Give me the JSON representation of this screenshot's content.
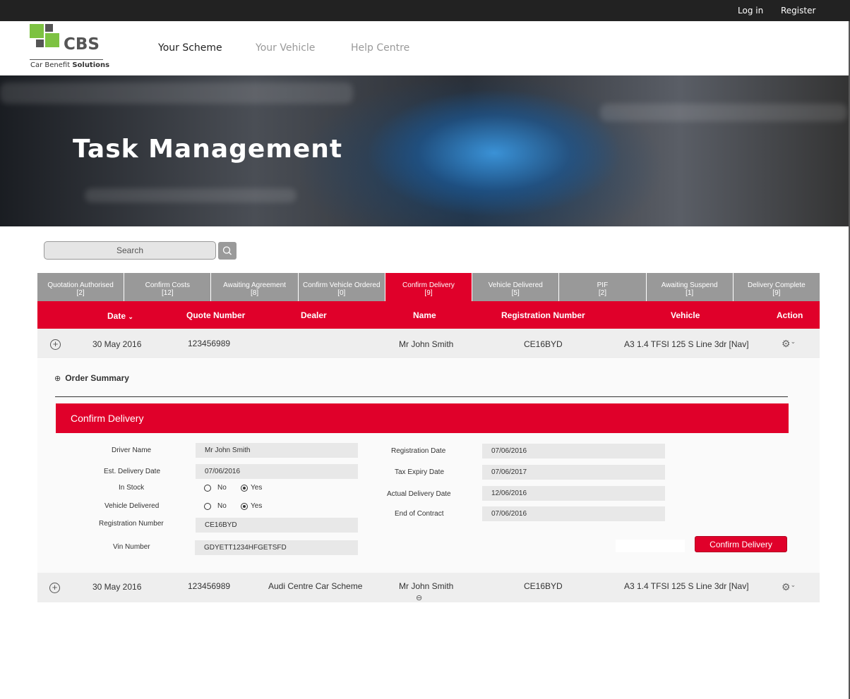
{
  "topbar": {
    "login": "Log in",
    "register": "Register"
  },
  "logo": {
    "text": "CBS",
    "subtitle_a": "Car Benefit ",
    "subtitle_b": "Solutions"
  },
  "nav": {
    "items": [
      "Your Scheme",
      "Your Vehicle",
      "Help Centre"
    ]
  },
  "hero": {
    "title": "Task Management"
  },
  "search": {
    "placeholder": "Search"
  },
  "tabs": [
    {
      "label": "Quotation Authorised",
      "count": "[2]"
    },
    {
      "label": "Confirm Costs",
      "count": "[12]"
    },
    {
      "label": "Awaiting Agreement",
      "count": "[8]"
    },
    {
      "label": "Confirm Vehicle Ordered",
      "count": "[0]"
    },
    {
      "label": "Confirm Delivery",
      "count": "[9]"
    },
    {
      "label": "Vehicle Delivered",
      "count": "[5]"
    },
    {
      "label": "PIF",
      "count": "[2]"
    },
    {
      "label": "Awaiting Suspend",
      "count": "[1]"
    },
    {
      "label": "Delivery Complete",
      "count": "[9]"
    }
  ],
  "table": {
    "headers": {
      "date": "Date",
      "quote": "Quote Number",
      "dealer": "Dealer",
      "name": "Name",
      "reg": "Registration Number",
      "vehicle": "Vehicle",
      "action": "Action"
    },
    "rows": [
      {
        "date": "30 May 2016",
        "quote": "123456989",
        "dealer": "",
        "name": "Mr John Smith",
        "reg": "CE16BYD",
        "vehicle": "A3 1.4 TFSI 125 S Line 3dr [Nav]"
      },
      {
        "date": "30 May 2016",
        "quote": "123456989",
        "dealer": "Audi Centre Car Scheme",
        "name": "Mr John Smith",
        "reg": "CE16BYD",
        "vehicle": "A3 1.4 TFSI 125 S Line 3dr [Nav]"
      }
    ]
  },
  "detail": {
    "order_summary": "Order Summary",
    "section_title": "Confirm Delivery",
    "labels": {
      "driver_name": "Driver Name",
      "est_delivery": "Est. Delivery Date",
      "in_stock": "In Stock",
      "vehicle_delivered": "Vehicle Delivered",
      "reg_number": "Registration Number",
      "vin": "Vin Number",
      "reg_date": "Registration Date",
      "tax_expiry": "Tax Expiry Date",
      "actual_delivery": "Actual Delivery Date",
      "end_contract": "End of Contract"
    },
    "values": {
      "driver_name": "Mr John Smith",
      "est_delivery": "07/06/2016",
      "reg_number": "CE16BYD",
      "vin": "GDYETT1234HFGETSFD",
      "reg_date": "07/06/2016",
      "tax_expiry": "07/06/2017",
      "actual_delivery": "12/06/2016",
      "end_contract": "07/06/2016"
    },
    "radio": {
      "no": "No",
      "yes": "Yes"
    },
    "confirm_button": "Confirm Delivery"
  },
  "colors": {
    "accent": "#e0002a",
    "tab_grey": "#999999",
    "topbar": "#222222",
    "logo_green": "#7dc242",
    "logo_grey": "#555555"
  }
}
